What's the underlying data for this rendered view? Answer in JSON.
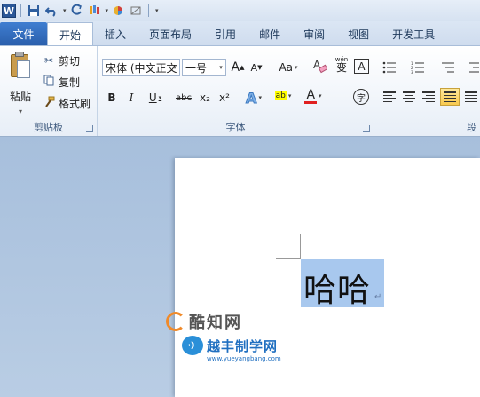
{
  "qat": {
    "app_icon": "W",
    "save_icon": "floppy-icon",
    "undo_icon": "undo-icon",
    "redo_icon": "redo-icon",
    "dropdown_arrow": "▾"
  },
  "tabs": [
    {
      "label": "文件"
    },
    {
      "label": "开始"
    },
    {
      "label": "插入"
    },
    {
      "label": "页面布局"
    },
    {
      "label": "引用"
    },
    {
      "label": "邮件"
    },
    {
      "label": "审阅"
    },
    {
      "label": "视图"
    },
    {
      "label": "开发工具"
    }
  ],
  "clipboard": {
    "paste_label": "粘贴",
    "cut_label": "剪切",
    "copy_label": "复制",
    "format_painter_label": "格式刷",
    "group_label": "剪贴板"
  },
  "font": {
    "font_name": "宋体 (中文正文",
    "font_size": "一号",
    "grow": "A",
    "shrink": "A",
    "case": "Aa",
    "clear": "A",
    "phonetic": "wén",
    "phonetic_char": "变",
    "border_char": "A",
    "bold": "B",
    "italic": "I",
    "underline": "U",
    "strike": "abc",
    "subscript": "x₂",
    "superscript": "x²",
    "effects": "A",
    "highlight": "ab",
    "color": "A",
    "enclose": "字",
    "group_label": "字体"
  },
  "paragraph": {
    "group_label": "段"
  },
  "document": {
    "text": "哈哈",
    "para_mark": "↵"
  },
  "watermarks": {
    "wm1_text": "酷知网",
    "wm2_text": "越丰制学网",
    "wm2_url": "www.yueyangbang.com"
  },
  "colors": {
    "file_tab": "#2a5fac",
    "selection": "#a8c8ee",
    "font_color_bar": "#e02020",
    "highlight_bar": "#ffff00"
  }
}
